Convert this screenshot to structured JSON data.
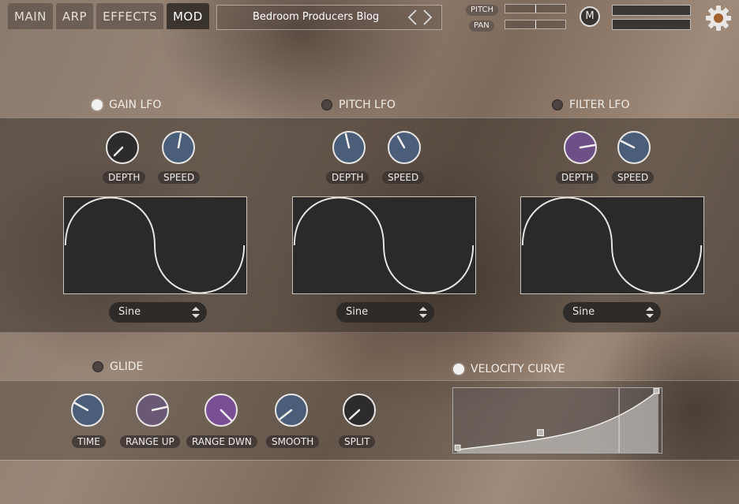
{
  "tabs": [
    {
      "label": "MAIN",
      "active": false
    },
    {
      "label": "ARP",
      "active": false
    },
    {
      "label": "EFFECTS",
      "active": false
    },
    {
      "label": "MOD",
      "active": true
    }
  ],
  "preset": {
    "name": "Bedroom Producers Blog"
  },
  "header": {
    "pitch_label": "PITCH",
    "pan_label": "PAN",
    "m_button": "M"
  },
  "lfos": [
    {
      "title": "GAIN LFO",
      "enabled": true,
      "depth_label": "DEPTH",
      "speed_label": "SPEED",
      "waveform": "Sine"
    },
    {
      "title": "PITCH LFO",
      "enabled": false,
      "depth_label": "DEPTH",
      "speed_label": "SPEED",
      "waveform": "Sine"
    },
    {
      "title": "FILTER LFO",
      "enabled": false,
      "depth_label": "DEPTH",
      "speed_label": "SPEED",
      "waveform": "Sine"
    }
  ],
  "glide": {
    "title": "GLIDE",
    "enabled": false,
    "knobs": [
      "TIME",
      "RANGE UP",
      "RANGE DWN",
      "SMOOTH",
      "SPLIT"
    ]
  },
  "velocity": {
    "title": "VELOCITY CURVE",
    "enabled": true
  },
  "colors": {
    "accent_blue": "#4a5e7a",
    "accent_purple": "#6e4f88",
    "panel_dark": "#2b2a2a"
  }
}
